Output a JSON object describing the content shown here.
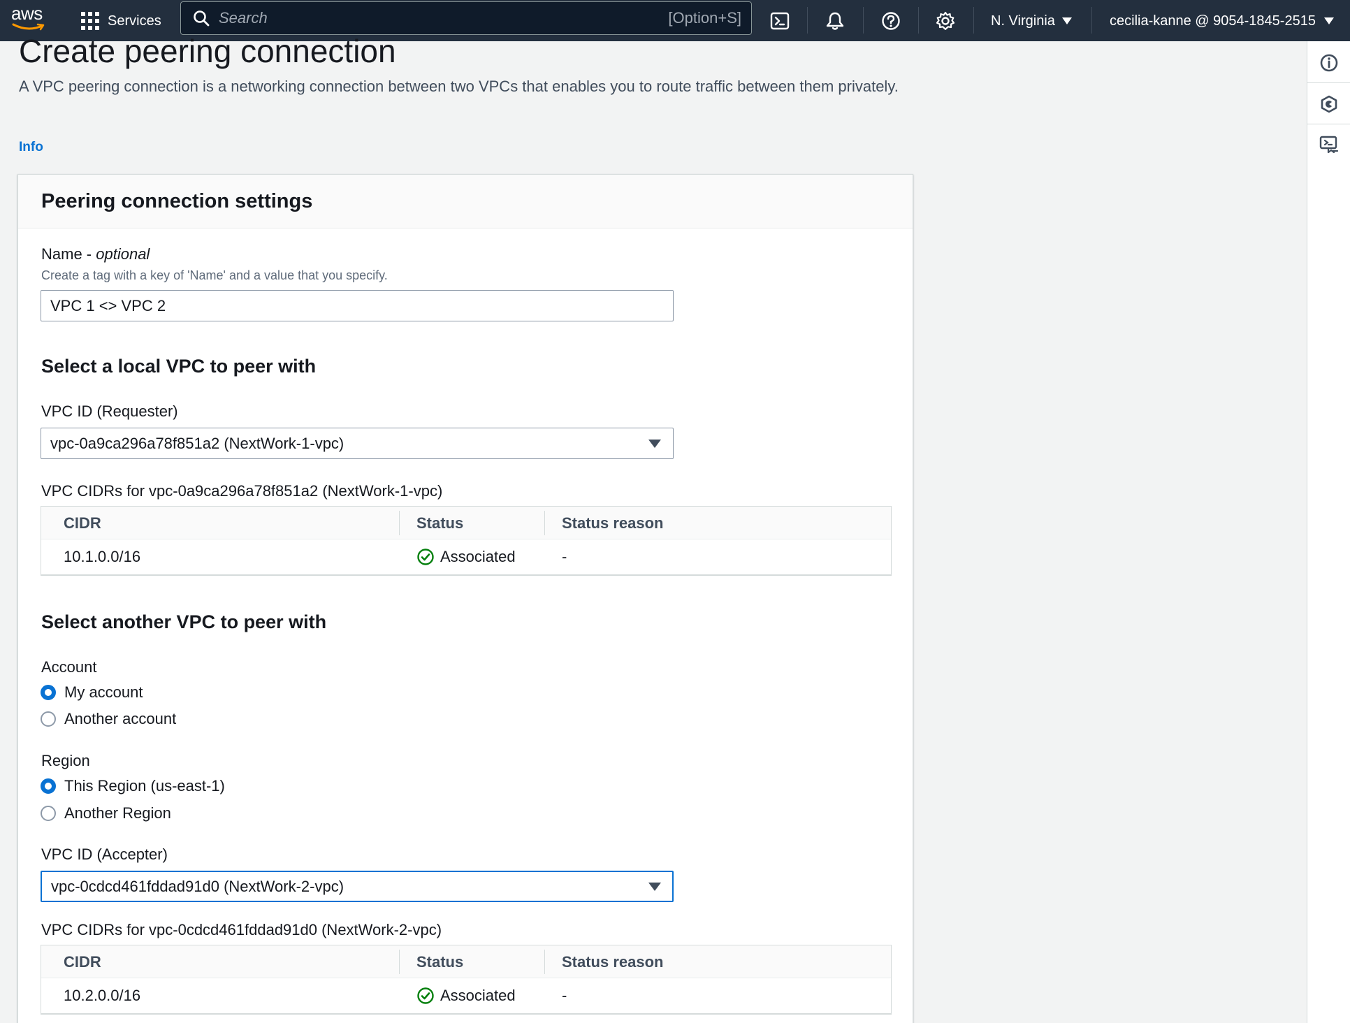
{
  "topnav": {
    "logo_text": "aws",
    "services_label": "Services",
    "search_placeholder": "Search",
    "search_shortcut": "[Option+S]",
    "icons": [
      "cloudshell-icon",
      "bell-icon",
      "help-icon",
      "gear-icon"
    ],
    "region": "N. Virginia",
    "account": "cecilia-kanne @ 9054-1845-2515"
  },
  "page": {
    "title": "Create peering connection",
    "description": "A VPC peering connection is a networking connection between two VPCs that enables you to route traffic between them privately.",
    "info_link": "Info"
  },
  "settings": {
    "heading": "Peering connection settings",
    "name_label": "Name - ",
    "name_optional": "optional",
    "name_hint": "Create a tag with a key of 'Name' and a value that you specify.",
    "name_value": "VPC 1 <> VPC 2"
  },
  "local_vpc": {
    "heading": "Select a local VPC to peer with",
    "vpc_id_label": "VPC ID (Requester)",
    "vpc_id_value": "vpc-0a9ca296a78f851a2 (NextWork-1-vpc)",
    "cidrs_label": "VPC CIDRs for vpc-0a9ca296a78f851a2 (NextWork-1-vpc)",
    "table": {
      "columns": [
        "CIDR",
        "Status",
        "Status reason"
      ],
      "rows": [
        {
          "cidr": "10.1.0.0/16",
          "status": "Associated",
          "reason": "-"
        }
      ]
    }
  },
  "other_vpc": {
    "heading": "Select another VPC to peer with",
    "account_label": "Account",
    "account_options": [
      "My account",
      "Another account"
    ],
    "account_selected": "My account",
    "region_label": "Region",
    "region_options": [
      "This Region (us-east-1)",
      "Another Region"
    ],
    "region_selected": "This Region (us-east-1)",
    "vpc_id_label": "VPC ID (Accepter)",
    "vpc_id_value": "vpc-0cdcd461fddad91d0 (NextWork-2-vpc)",
    "cidrs_label": "VPC CIDRs for vpc-0cdcd461fddad91d0 (NextWork-2-vpc)",
    "table": {
      "columns": [
        "CIDR",
        "Status",
        "Status reason"
      ],
      "rows": [
        {
          "cidr": "10.2.0.0/16",
          "status": "Associated",
          "reason": "-"
        }
      ]
    }
  },
  "colors": {
    "nav_bg": "#232f3e",
    "link": "#0972d3",
    "success": "#037f0c",
    "radio_checked": "#0972d3"
  }
}
